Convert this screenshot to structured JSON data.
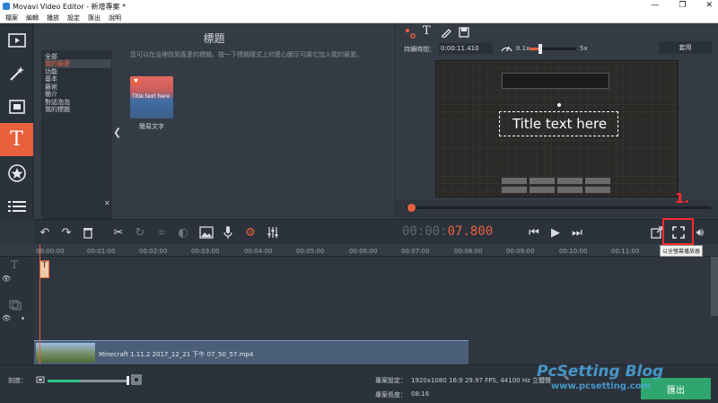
{
  "window": {
    "title": "Movavi Video Editor - 新增專案 *",
    "controls": [
      "—",
      "❐",
      "✕"
    ]
  },
  "menu": [
    "檔案",
    "編輯",
    "播放",
    "設定",
    "匯出",
    "說明"
  ],
  "titles_panel": {
    "heading": "標題",
    "categories": [
      "全部",
      "我的最愛",
      "功能",
      "基本",
      "藝術",
      "簡介",
      "對話泡泡",
      "我的標題"
    ],
    "selected_category": "我的最愛",
    "hint": "您可以在這裡找到喜愛的標題。按一下標題樣式上的愛心圖示可將它加入我的最愛。",
    "thumbnail": {
      "text": "Title text here",
      "caption": "簡易文字"
    }
  },
  "preview_toolbar": {
    "trim_label": "持續時間：",
    "duration_value": "0:00:11.410",
    "speed_min": "0.1x",
    "speed_max": "5x",
    "speed_level": 0.05,
    "apply_label": "套用"
  },
  "preview": {
    "title_text": "Title text here",
    "progress": 0.0
  },
  "timecode": {
    "dim": "00:00:",
    "accent": "07.800"
  },
  "ruler": [
    "00:00:00",
    "00:01:00",
    "00:02:00",
    "00:03:00",
    "00:04:00",
    "00:05:00",
    "00:06:00",
    "00:07:00",
    "00:08:00",
    "00:09:00",
    "00:10:00",
    "00:11:00"
  ],
  "timeline": {
    "title_clip_label": "T",
    "video_clip_name": "Minecraft 1.11.2 2017_12_21 下午 07_50_57.mp4"
  },
  "statusbar": {
    "zoom_label": "刻度：",
    "zoom_level": 0.4,
    "settings_label": "專案設定：",
    "settings_value": "1920x1080 16:9 29.97 FPS, 44100 Hz 立體聲",
    "duration_label": "專案長度：",
    "duration_value": "08:16",
    "export_label": "匯出"
  },
  "annotation": {
    "number": "1.",
    "tooltip": "以全螢幕播放器"
  },
  "watermark": {
    "line1": "PcSetting Blog",
    "line2": "www.pcsetting.com"
  },
  "colors": {
    "accent": "#e9603c",
    "export": "#2fa66d",
    "annotation": "#ff2a2a"
  }
}
